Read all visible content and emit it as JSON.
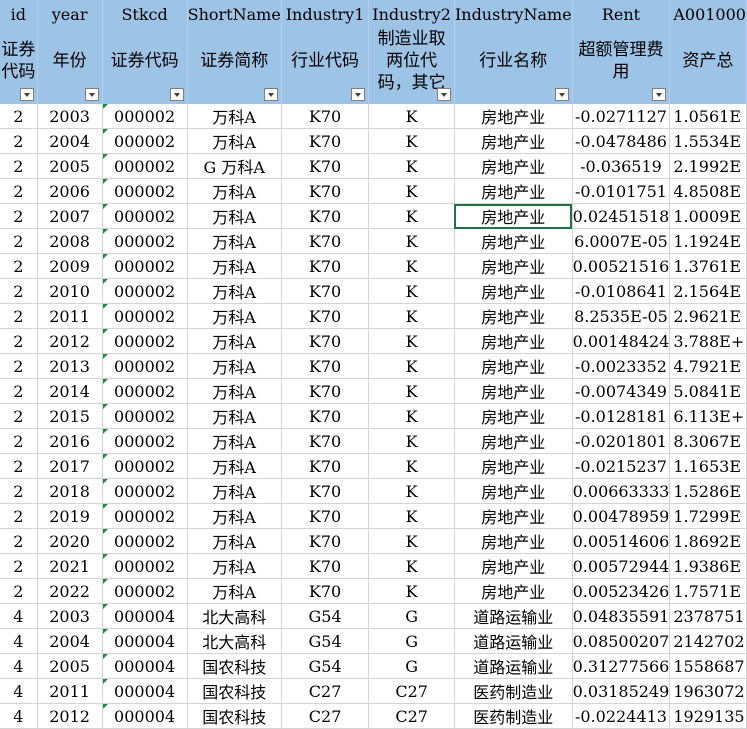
{
  "headers_en": [
    "id",
    "year",
    "Stkcd",
    "ShortName",
    "Industry1",
    "Industry2",
    "IndustryName",
    "Rent",
    "A001000"
  ],
  "headers_cn": [
    "证券代码",
    "年份",
    "证券代码",
    "证券简称",
    "行业代码",
    "制造业取两位代码，其它",
    "行业名称",
    "超额管理费用",
    "资产总"
  ],
  "rows": [
    [
      "2",
      "2003",
      "000002",
      "万科A",
      "K70",
      "K",
      "房地产业",
      "-0.0271127",
      "1.0561E"
    ],
    [
      "2",
      "2004",
      "000002",
      "万科A",
      "K70",
      "K",
      "房地产业",
      "-0.0478486",
      "1.5534E"
    ],
    [
      "2",
      "2005",
      "000002",
      "G 万科A",
      "K70",
      "K",
      "房地产业",
      "-0.036519",
      "2.1992E"
    ],
    [
      "2",
      "2006",
      "000002",
      "万科A",
      "K70",
      "K",
      "房地产业",
      "-0.0101751",
      "4.8508E"
    ],
    [
      "2",
      "2007",
      "000002",
      "万科A",
      "K70",
      "K",
      "房地产业",
      "0.02451518",
      "1.0009E"
    ],
    [
      "2",
      "2008",
      "000002",
      "万科A",
      "K70",
      "K",
      "房地产业",
      "6.0007E-05",
      "1.1924E"
    ],
    [
      "2",
      "2009",
      "000002",
      "万科A",
      "K70",
      "K",
      "房地产业",
      "0.00521516",
      "1.3761E"
    ],
    [
      "2",
      "2010",
      "000002",
      "万科A",
      "K70",
      "K",
      "房地产业",
      "-0.0108641",
      "2.1564E"
    ],
    [
      "2",
      "2011",
      "000002",
      "万科A",
      "K70",
      "K",
      "房地产业",
      "8.2535E-05",
      "2.9621E"
    ],
    [
      "2",
      "2012",
      "000002",
      "万科A",
      "K70",
      "K",
      "房地产业",
      "0.00148424",
      "3.788E+"
    ],
    [
      "2",
      "2013",
      "000002",
      "万科A",
      "K70",
      "K",
      "房地产业",
      "-0.0023352",
      "4.7921E"
    ],
    [
      "2",
      "2014",
      "000002",
      "万科A",
      "K70",
      "K",
      "房地产业",
      "-0.0074349",
      "5.0841E"
    ],
    [
      "2",
      "2015",
      "000002",
      "万科A",
      "K70",
      "K",
      "房地产业",
      "-0.0128181",
      "6.113E+"
    ],
    [
      "2",
      "2016",
      "000002",
      "万科A",
      "K70",
      "K",
      "房地产业",
      "-0.0201801",
      "8.3067E"
    ],
    [
      "2",
      "2017",
      "000002",
      "万科A",
      "K70",
      "K",
      "房地产业",
      "-0.0215237",
      "1.1653E"
    ],
    [
      "2",
      "2018",
      "000002",
      "万科A",
      "K70",
      "K",
      "房地产业",
      "0.00663333",
      "1.5286E"
    ],
    [
      "2",
      "2019",
      "000002",
      "万科A",
      "K70",
      "K",
      "房地产业",
      "0.00478959",
      "1.7299E"
    ],
    [
      "2",
      "2020",
      "000002",
      "万科A",
      "K70",
      "K",
      "房地产业",
      "0.00514606",
      "1.8692E"
    ],
    [
      "2",
      "2021",
      "000002",
      "万科A",
      "K70",
      "K",
      "房地产业",
      "0.00572944",
      "1.9386E"
    ],
    [
      "2",
      "2022",
      "000002",
      "万科A",
      "K70",
      "K",
      "房地产业",
      "0.00523426",
      "1.7571E"
    ],
    [
      "4",
      "2003",
      "000004",
      "北大高科",
      "G54",
      "G",
      "道路运输业",
      "0.04835591",
      "2378751"
    ],
    [
      "4",
      "2004",
      "000004",
      "北大高科",
      "G54",
      "G",
      "道路运输业",
      "0.08500207",
      "2142702"
    ],
    [
      "4",
      "2005",
      "000004",
      "国农科技",
      "G54",
      "G",
      "道路运输业",
      "0.31277566",
      "1558687"
    ],
    [
      "4",
      "2011",
      "000004",
      "国农科技",
      "C27",
      "C27",
      "医药制造业",
      "0.03185249",
      "1963072"
    ],
    [
      "4",
      "2012",
      "000004",
      "国农科技",
      "C27",
      "C27",
      "医药制造业",
      "-0.0224413",
      "1929135"
    ]
  ],
  "selected_cell": {
    "row": 4,
    "col": 6
  },
  "colors": {
    "header_bg": "#9dc3e6",
    "selection": "#217346",
    "text_marker": "#1e8e3e"
  }
}
